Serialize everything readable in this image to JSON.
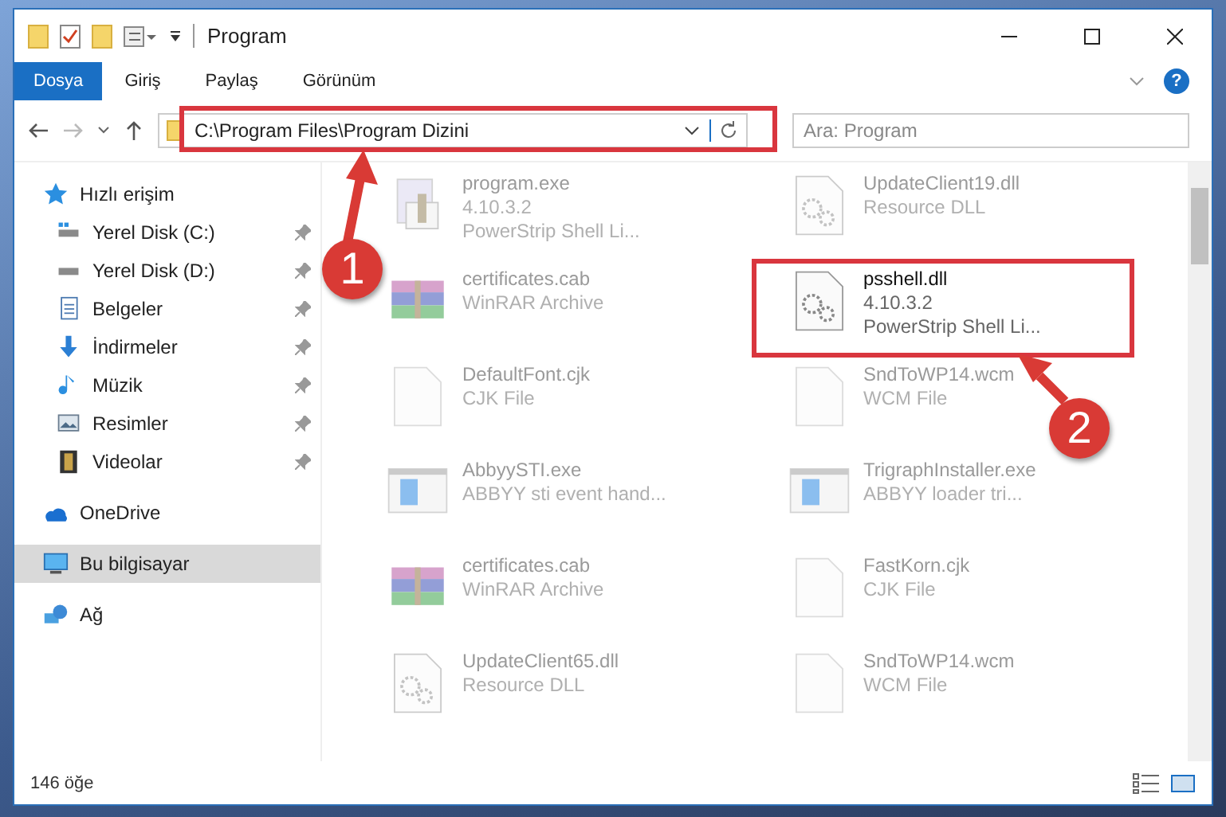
{
  "window": {
    "title": "Program"
  },
  "ribbon": {
    "file_button": "Dosya",
    "tabs": [
      {
        "label": "Giriş",
        "selected": false
      },
      {
        "label": "Paylaş",
        "selected": false
      },
      {
        "label": "Görünüm",
        "selected": false
      }
    ],
    "help": "?"
  },
  "address_bar": {
    "path": "C:\\Program Files\\Program Dizini"
  },
  "search": {
    "placeholder": "Ara: Program"
  },
  "sidebar": {
    "quick_access": {
      "label": "Hızlı erişim",
      "children": [
        {
          "label": "Yerel Disk (C:)",
          "pinned": true
        },
        {
          "label": "Yerel Disk (D:)",
          "pinned": true
        },
        {
          "label": "Belgeler",
          "pinned": true
        },
        {
          "label": "İndirmeler",
          "pinned": true
        },
        {
          "label": "Müzik",
          "pinned": true
        },
        {
          "label": "Resimler",
          "pinned": true
        },
        {
          "label": "Videolar",
          "pinned": true
        }
      ]
    },
    "items": [
      {
        "label": "OneDrive",
        "selected": false
      },
      {
        "label": "Bu bilgisayar",
        "selected": true
      },
      {
        "label": "Ağ",
        "selected": false
      }
    ]
  },
  "files": [
    {
      "kind": "installer",
      "name": "program.exe",
      "lines": [
        "4.10.3.2",
        "PowerStrip Shell Li..."
      ],
      "dimmed": true
    },
    {
      "kind": "dll",
      "name": "UpdateClient19.dll",
      "lines": [
        "Resource DLL"
      ],
      "dimmed": true
    },
    {
      "kind": "archive",
      "name": "certificates.cab",
      "lines": [
        "WinRAR Archive"
      ],
      "dimmed": true
    },
    {
      "kind": "dll",
      "name": "psshell.dll",
      "lines": [
        "4.10.3.2",
        "PowerStrip Shell Li..."
      ],
      "dimmed": false
    },
    {
      "kind": "blank",
      "name": "DefaultFont.cjk",
      "lines": [
        "CJK File"
      ],
      "dimmed": true
    },
    {
      "kind": "blank",
      "name": "SndToWP14.wcm",
      "lines": [
        "WCM File"
      ],
      "dimmed": true
    },
    {
      "kind": "app",
      "name": "AbbyySTI.exe",
      "lines": [
        "ABBYY sti event hand..."
      ],
      "dimmed": true
    },
    {
      "kind": "app",
      "name": "TrigraphInstaller.exe",
      "lines": [
        "ABBYY loader tri..."
      ],
      "dimmed": true
    },
    {
      "kind": "archive",
      "name": "certificates.cab",
      "lines": [
        "WinRAR Archive"
      ],
      "dimmed": true
    },
    {
      "kind": "blank",
      "name": "FastKorn.cjk",
      "lines": [
        "CJK File"
      ],
      "dimmed": true
    },
    {
      "kind": "dll",
      "name": "UpdateClient65.dll",
      "lines": [
        "Resource DLL"
      ],
      "dimmed": true
    },
    {
      "kind": "blank",
      "name": "SndToWP14.wcm",
      "lines": [
        "WCM File"
      ],
      "dimmed": true
    }
  ],
  "status_bar": {
    "count": "146 öğe"
  },
  "annotations": [
    {
      "label": "1"
    },
    {
      "label": "2"
    }
  ]
}
